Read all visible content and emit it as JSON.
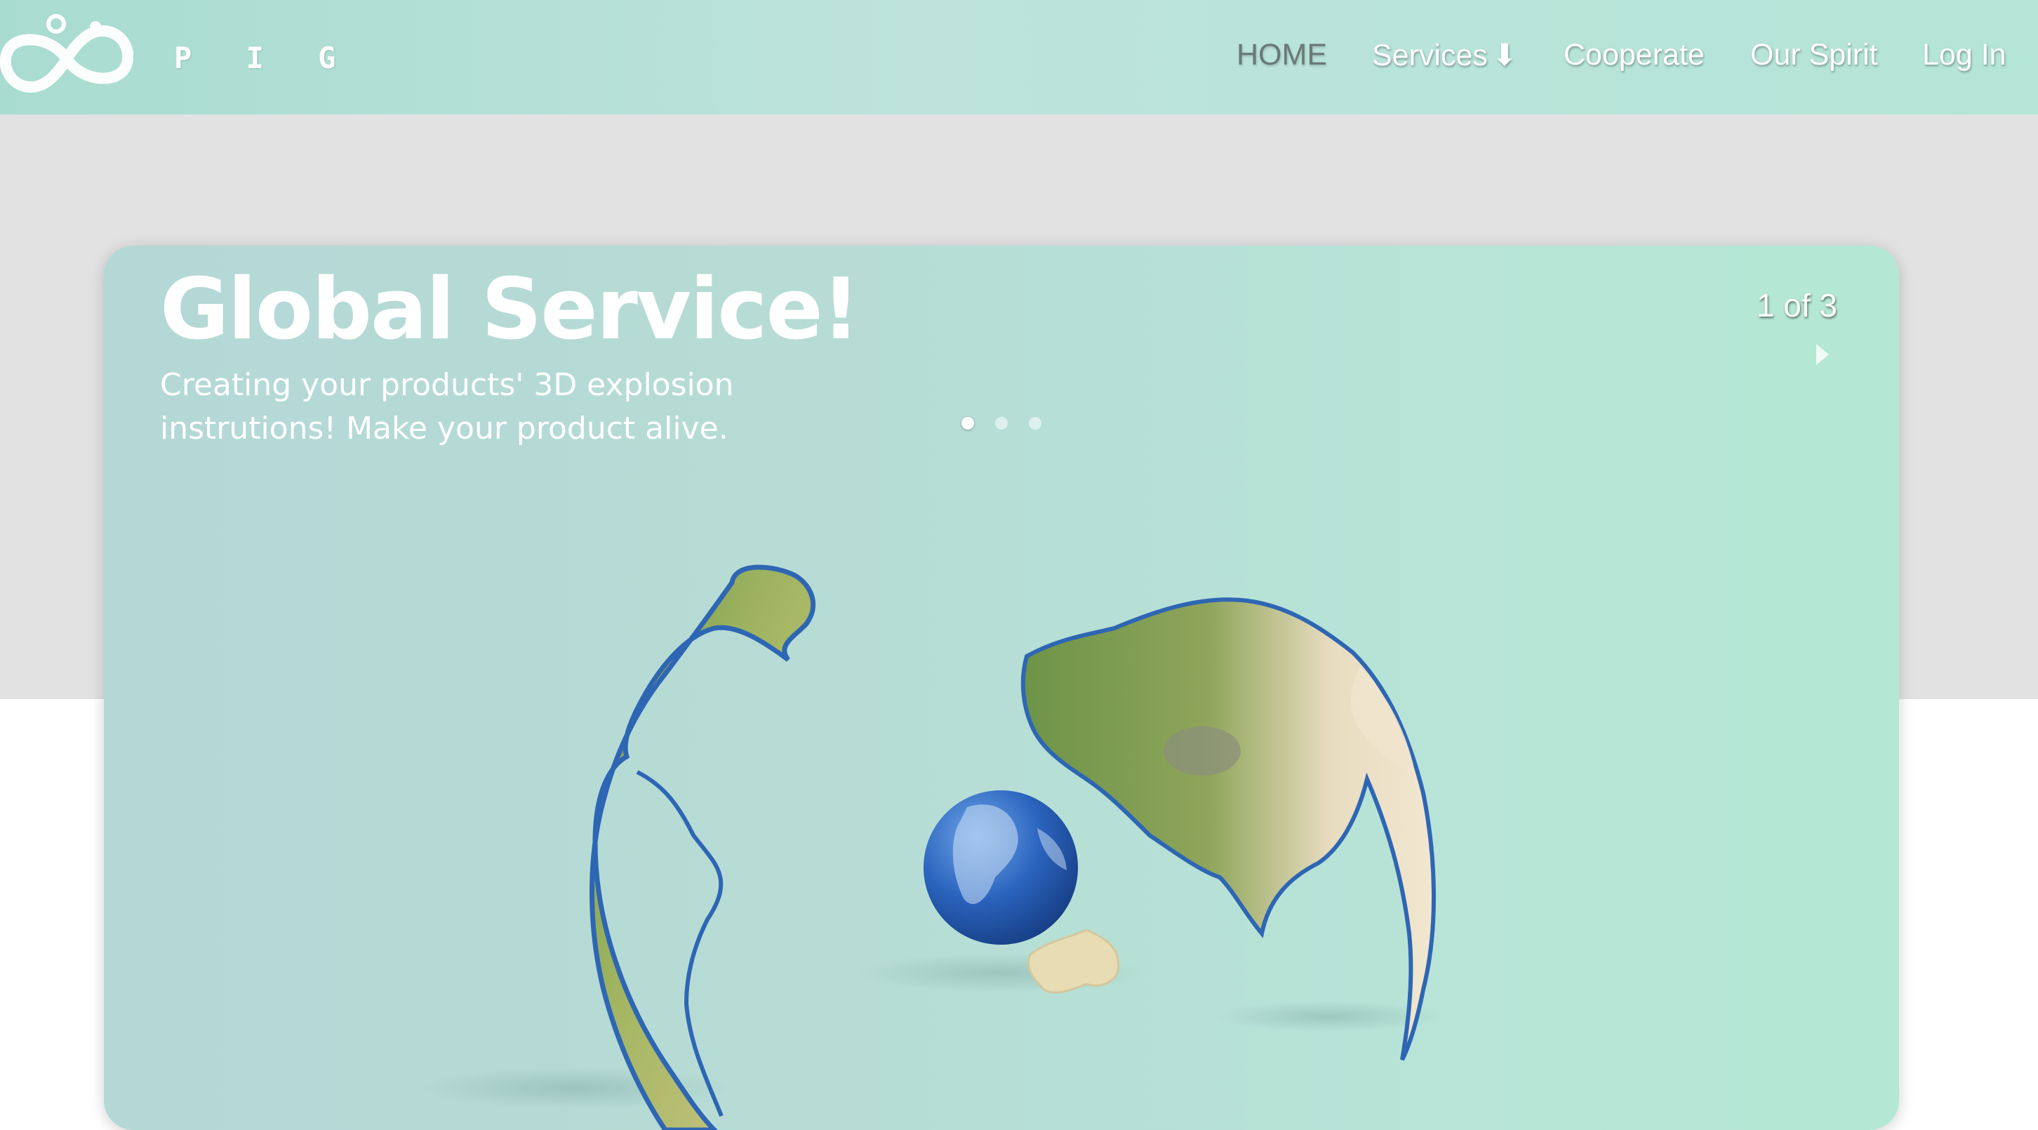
{
  "navbar": {
    "brand": "P I G",
    "links": [
      {
        "label": "HOME",
        "active": true
      },
      {
        "label": "Services",
        "icon": "arrow-down-icon"
      },
      {
        "label": "Cooperate"
      },
      {
        "label": "Our Spirit"
      },
      {
        "label": "Log In"
      }
    ],
    "services_arrow": "⬇"
  },
  "hero": {
    "title": "Global Service!",
    "subtitle_line1": "Creating your products' 3D explosion",
    "subtitle_line2": "instrutions! Make your product alive.",
    "counter": "1 of 3",
    "slide_count": 3,
    "active_slide": 1,
    "image": "exploded-globe-illustration"
  },
  "colors": {
    "navbar": "#b8e0d8",
    "background_band": "#e2e2e2",
    "card": "#b6dfd6",
    "text": "#ffffff",
    "nav_active": "#6a7a75"
  }
}
